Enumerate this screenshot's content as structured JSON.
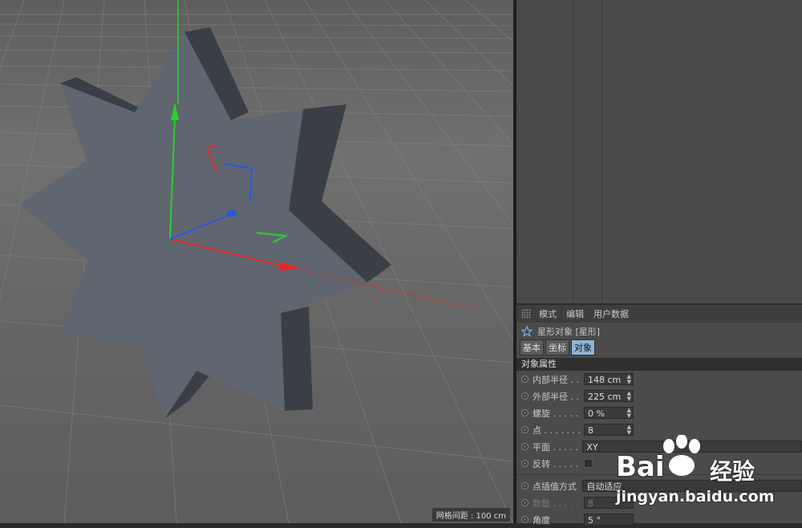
{
  "viewport": {
    "grid_info": "网格间距 : 100 cm"
  },
  "attributes": {
    "menu": [
      "模式",
      "编辑",
      "用户数据"
    ],
    "object_title": "星形对象 [星形]",
    "tabs": [
      "基本",
      "坐标",
      "对象"
    ],
    "section": "对象属性",
    "fields": {
      "inner_radius": {
        "label": "内部半径 . .",
        "value": "148 cm"
      },
      "outer_radius": {
        "label": "外部半径 . .",
        "value": "225 cm"
      },
      "twist": {
        "label": "螺旋 . . . . .",
        "value": "0 %"
      },
      "points": {
        "label": "点 . . . . . . .",
        "value": "8"
      },
      "plane": {
        "label": "平面 . . . . .",
        "value": "XY"
      },
      "reverse": {
        "label": "反转 . . . . ."
      },
      "interpolation": {
        "label": "点插值方式",
        "value": "自动适应"
      },
      "count": {
        "label": "数量 . . . . .",
        "value": "8"
      },
      "angle": {
        "label": "角度",
        "value": "5 °"
      }
    }
  },
  "watermark": {
    "brand": "Bai",
    "brand_cn": "经验",
    "url": "jingyan.baidu.com"
  },
  "colors": {
    "x_axis": "#e02a2a",
    "y_axis": "#2ad02a",
    "z_axis": "#2a55e0",
    "active_tab": "#8fb6d8",
    "star_face": "#5f6670",
    "star_side": "#3a3f45"
  }
}
